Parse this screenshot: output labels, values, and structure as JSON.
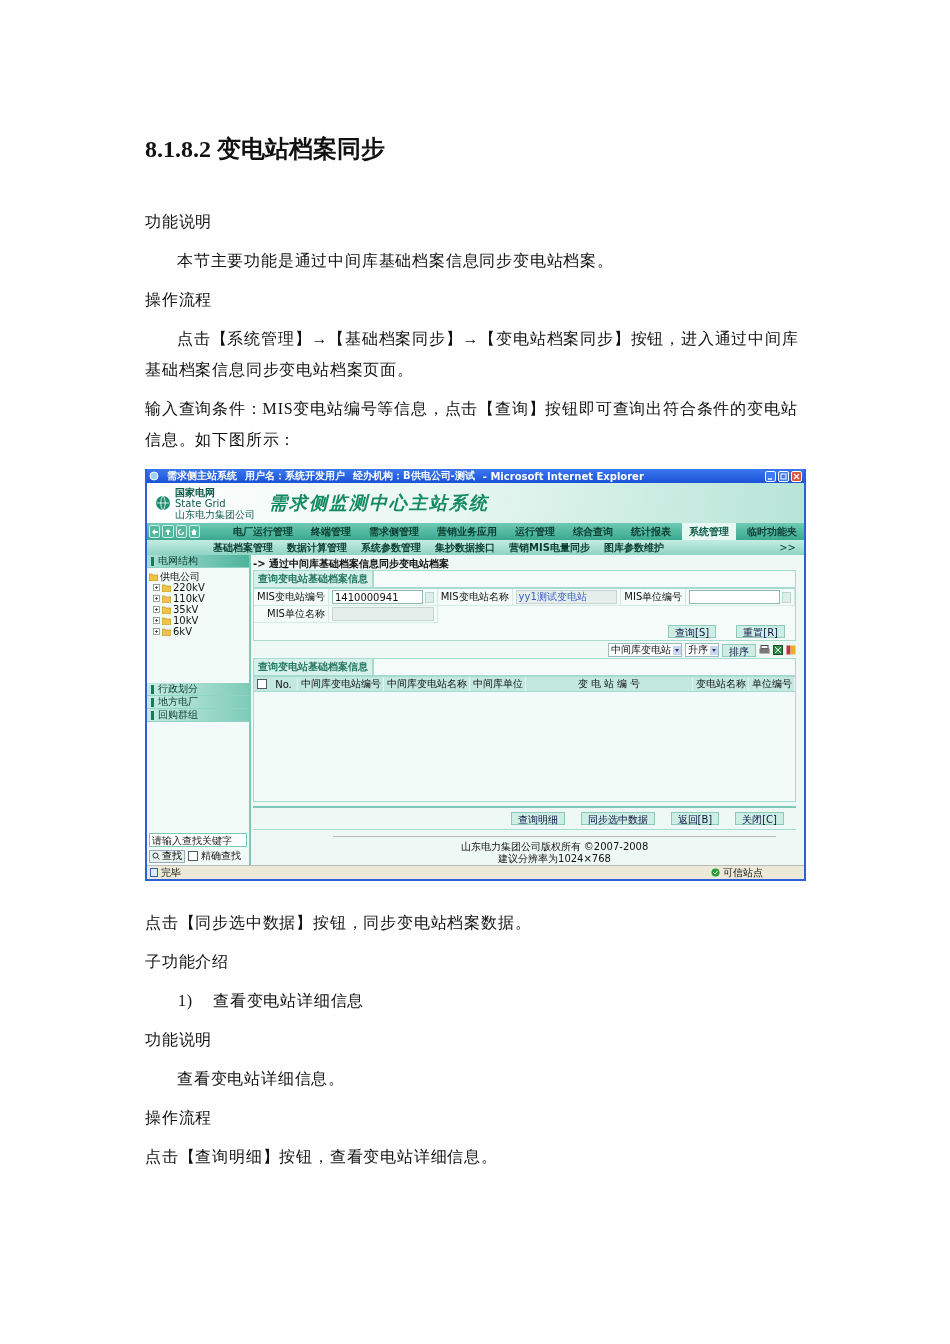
{
  "heading": "8.1.8.2 变电站档案同步",
  "blocks_before": [
    {
      "kind": "plain",
      "text": "功能说明"
    },
    {
      "kind": "indent",
      "text": "本节主要功能是通过中间库基础档案信息同步变电站档案。"
    },
    {
      "kind": "plain",
      "text": "操作流程"
    },
    {
      "kind": "indent",
      "text": "点击【系统管理】→【基础档案同步】→【变电站档案同步】按钮，进入通过中间库基础档案信息同步变电站档案页面。"
    },
    {
      "kind": "plain",
      "text": "输入查询条件：MIS变电站编号等信息，点击【查询】按钮即可查询出符合条件的变电站信息。如下图所示："
    }
  ],
  "screenshot": {
    "window": {
      "title": "需求侧主站系统",
      "user": "用户名：系统开发用户",
      "org": "经办机构：B供电公司-测试",
      "browser": "- Microsoft Internet Explorer"
    },
    "banner": {
      "logo_name": "国家电网",
      "logo_en": "State Grid",
      "logo_company": "山东电力集团公司",
      "system_title": "需求侧监测中心主站系统"
    },
    "menu": [
      {
        "label": "电厂运行管理",
        "selected": false
      },
      {
        "label": "终端管理",
        "selected": false
      },
      {
        "label": "需求侧管理",
        "selected": false
      },
      {
        "label": "营销业务应用",
        "selected": false
      },
      {
        "label": "运行管理",
        "selected": false
      },
      {
        "label": "综合查询",
        "selected": false
      },
      {
        "label": "统计报表",
        "selected": false
      },
      {
        "label": "系统管理",
        "selected": true
      },
      {
        "label": "临时功能夹",
        "selected": false
      }
    ],
    "submenu": {
      "items": [
        "基础档案管理",
        "数据计算管理",
        "系统参数管理",
        "集抄数据接口",
        "营销MIS电量同步",
        "图库参数维护"
      ],
      "more": ">>"
    },
    "sidebar": {
      "panels": [
        {
          "title": "电网结构",
          "expanded": true,
          "tree": [
            {
              "label": "供电公司",
              "children": [
                {
                  "label": "220kV",
                  "expanded": false
                },
                {
                  "label": "110kV",
                  "expanded": false
                },
                {
                  "label": "35kV",
                  "expanded": false
                },
                {
                  "label": "10kV",
                  "expanded": false
                },
                {
                  "label": "6kV",
                  "expanded": false
                }
              ]
            }
          ]
        },
        {
          "title": "行政划分",
          "expanded": false
        },
        {
          "title": "地方电厂",
          "expanded": false
        },
        {
          "title": "回购群组",
          "expanded": false
        }
      ],
      "search": {
        "placeholder": "请输入查找关键字",
        "button": "查找",
        "exact": {
          "label": "精确查找",
          "checked": false
        }
      }
    },
    "breadcrumb": "-> 通过中间库基础档案信息同步变电站档案",
    "query_form": {
      "tab": "查询变电站基础档案信息",
      "fields": [
        {
          "label": "MIS变电站编号",
          "value": "1410000941",
          "kind": "lookup",
          "disabled": false
        },
        {
          "label": "MIS变电站名称",
          "value": "yy1测试变电站",
          "kind": "plain",
          "disabled": true
        },
        {
          "label": "MIS单位编号",
          "kind": "lookup",
          "disabled": false
        },
        {
          "label": "MIS单位名称",
          "kind": "plain",
          "disabled": true
        }
      ],
      "buttons": [
        "查询[S]",
        "重置[R]"
      ]
    },
    "result": {
      "tab": "查询变电站基础档案信息",
      "sort": {
        "field": "中间库变电站",
        "order": "升序",
        "button": "排序"
      },
      "select_all": {
        "checked": false
      },
      "columns": [
        "No.",
        "中间库变电站编号",
        "中间库变电站名称",
        "中间库单位",
        "变 电 站 编 号",
        "变电站名称",
        "单位编号"
      ]
    },
    "actions": [
      "查询明细",
      "同步选中数据",
      "返回[B]",
      "关闭[C]"
    ],
    "footer": {
      "copyright": "山东电力集团公司版权所有 ©2007-2008",
      "resolution": "建议分辨率为1024×768"
    },
    "status_bar": {
      "text": "完毕",
      "zone": "可信站点"
    }
  },
  "blocks_after": [
    {
      "kind": "plain",
      "text": "点击【同步选中数据】按钮，同步变电站档案数据。"
    },
    {
      "kind": "plain",
      "text": "子功能介绍"
    },
    {
      "kind": "numbered",
      "number": "1)",
      "text": "查看变电站详细信息"
    },
    {
      "kind": "plain",
      "text": "功能说明"
    },
    {
      "kind": "indent",
      "text": "查看变电站详细信息。"
    },
    {
      "kind": "plain",
      "text": "操作流程"
    },
    {
      "kind": "plain",
      "text": "点击【查询明细】按钮，查看变电站详细信息。"
    }
  ]
}
